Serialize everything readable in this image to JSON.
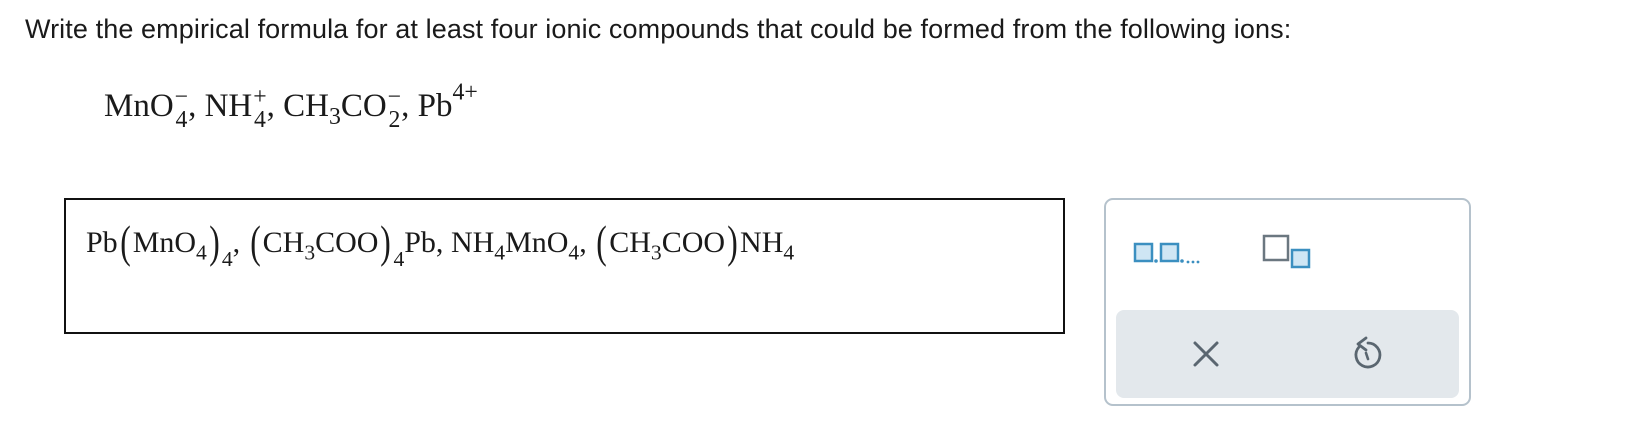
{
  "question": {
    "text": "Write the empirical formula for at least four ionic compounds that could be formed from the following ions:"
  },
  "ions": {
    "mno4": {
      "base": "MnO",
      "sub": "4",
      "charge": "−"
    },
    "nh4": {
      "base": "NH",
      "sub": "4",
      "charge": "+"
    },
    "ch3co2": {
      "base1": "CH",
      "sub1": "3",
      "base2": "CO",
      "sub2": "2",
      "charge": "−"
    },
    "pb": {
      "base": "Pb",
      "charge": "4+"
    },
    "sep": ","
  },
  "answer": {
    "c1_pb": "Pb",
    "c1_inner": "MnO",
    "c1_inner_sub": "4",
    "c1_outer_sub": "4",
    "sep1": ",",
    "c2_inner_a": "CH",
    "c2_inner_sub": "3",
    "c2_inner_b": "COO",
    "c2_outer_sub": "4",
    "c2_pb": "Pb,",
    "c3_a": "NH",
    "c3_sub1": "4",
    "c3_b": "MnO",
    "c3_sub2": "4",
    "sep3": ",",
    "c4_inner_a": "CH",
    "c4_inner_sub": "3",
    "c4_inner_b": "COO",
    "c4_c": "NH",
    "c4_sub": "4",
    "lparen": "(",
    "rparen": ")"
  },
  "toolbar": {
    "list_icon": "comma-list-icon",
    "subscript_icon": "subscript-template-icon",
    "clear_icon": "close-icon",
    "undo_icon": "undo-icon"
  },
  "colors": {
    "tool_blue": "#3b8fc0",
    "panel_border": "#b5c2cc",
    "action_bg": "#e3e8ec",
    "icon_gray": "#5a6670"
  }
}
